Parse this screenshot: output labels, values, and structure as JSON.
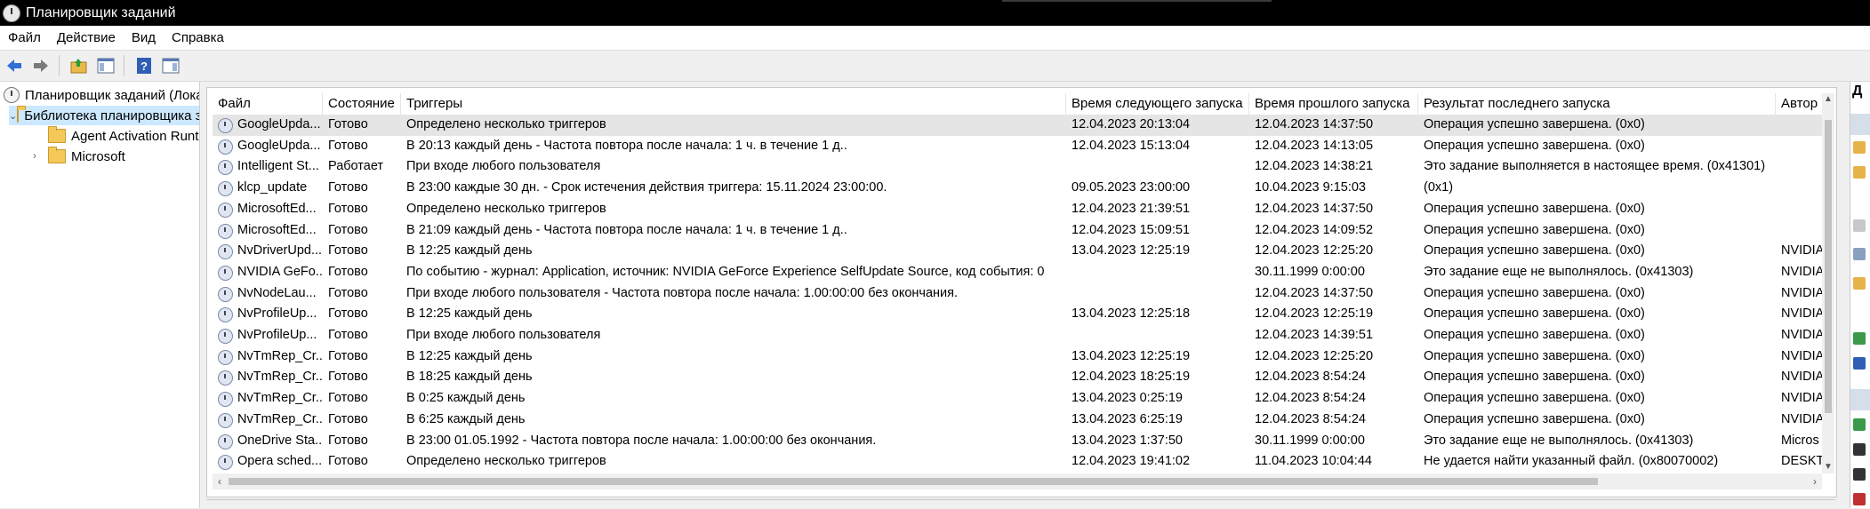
{
  "window": {
    "title": "Планировщик заданий"
  },
  "menu": [
    "Файл",
    "Действие",
    "Вид",
    "Справка"
  ],
  "tree": {
    "root": "Планировщик заданий (Локальный)",
    "library": "Библиотека планировщика заданий",
    "children": [
      "Agent Activation Runtime",
      "Microsoft"
    ]
  },
  "table": {
    "columns": [
      "Файл",
      "Состояние",
      "Триггеры",
      "Время следующего запуска",
      "Время прошлого запуска",
      "Результат последнего запуска",
      "Автор"
    ],
    "rows": [
      [
        "GoogleUpda...",
        "Готово",
        "Определено несколько триггеров",
        "12.04.2023 20:13:04",
        "12.04.2023 14:37:50",
        "Операция успешно завершена. (0x0)",
        ""
      ],
      [
        "GoogleUpda...",
        "Готово",
        "В 20:13 каждый день - Частота повтора после начала: 1 ч. в течение 1 д..",
        "12.04.2023 15:13:04",
        "12.04.2023 14:13:05",
        "Операция успешно завершена. (0x0)",
        ""
      ],
      [
        "Intelligent St...",
        "Работает",
        "При входе любого пользователя",
        "",
        "12.04.2023 14:38:21",
        "Это задание выполняется в настоящее время. (0x41301)",
        ""
      ],
      [
        "klcp_update",
        "Готово",
        "В 23:00 каждые 30 дн. - Срок истечения действия триггера: 15.11.2024 23:00:00.",
        "09.05.2023 23:00:00",
        "10.04.2023 9:15:03",
        "(0x1)",
        ""
      ],
      [
        "MicrosoftEd...",
        "Готово",
        "Определено несколько триггеров",
        "12.04.2023 21:39:51",
        "12.04.2023 14:37:50",
        "Операция успешно завершена. (0x0)",
        ""
      ],
      [
        "MicrosoftEd...",
        "Готово",
        "В 21:09 каждый день - Частота повтора после начала: 1 ч. в течение 1 д..",
        "12.04.2023 15:09:51",
        "12.04.2023 14:09:52",
        "Операция успешно завершена. (0x0)",
        ""
      ],
      [
        "NvDriverUpd...",
        "Готово",
        "В 12:25 каждый день",
        "13.04.2023 12:25:19",
        "12.04.2023 12:25:20",
        "Операция успешно завершена. (0x0)",
        "NVIDIA"
      ],
      [
        "NVIDIA GeFo...",
        "Готово",
        "По событию - журнал: Application, источник: NVIDIA GeForce Experience SelfUpdate Source, код события: 0",
        "",
        "30.11.1999 0:00:00",
        "Это задание еще не выполнялось. (0x41303)",
        "NVIDIA"
      ],
      [
        "NvNodeLau...",
        "Готово",
        "При входе любого пользователя - Частота повтора после начала: 1.00:00:00 без окончания.",
        "",
        "12.04.2023 14:37:50",
        "Операция успешно завершена. (0x0)",
        "NVIDIA"
      ],
      [
        "NvProfileUp...",
        "Готово",
        "В 12:25 каждый день",
        "13.04.2023 12:25:18",
        "12.04.2023 12:25:19",
        "Операция успешно завершена. (0x0)",
        "NVIDIA"
      ],
      [
        "NvProfileUp...",
        "Готово",
        "При входе любого пользователя",
        "",
        "12.04.2023 14:39:51",
        "Операция успешно завершена. (0x0)",
        "NVIDIA"
      ],
      [
        "NvTmRep_Cr...",
        "Готово",
        "В 12:25 каждый день",
        "13.04.2023 12:25:19",
        "12.04.2023 12:25:20",
        "Операция успешно завершена. (0x0)",
        "NVIDIA"
      ],
      [
        "NvTmRep_Cr...",
        "Готово",
        "В 18:25 каждый день",
        "12.04.2023 18:25:19",
        "12.04.2023 8:54:24",
        "Операция успешно завершена. (0x0)",
        "NVIDIA"
      ],
      [
        "NvTmRep_Cr...",
        "Готово",
        "В 0:25 каждый день",
        "13.04.2023 0:25:19",
        "12.04.2023 8:54:24",
        "Операция успешно завершена. (0x0)",
        "NVIDIA"
      ],
      [
        "NvTmRep_Cr...",
        "Готово",
        "В 6:25 каждый день",
        "13.04.2023 6:25:19",
        "12.04.2023 8:54:24",
        "Операция успешно завершена. (0x0)",
        "NVIDIA"
      ],
      [
        "OneDrive Sta...",
        "Готово",
        "В 23:00 01.05.1992 - Частота повтора после начала: 1.00:00:00 без окончания.",
        "13.04.2023 1:37:50",
        "30.11.1999 0:00:00",
        "Это задание еще не выполнялось. (0x41303)",
        "Micros"
      ],
      [
        "Opera sched...",
        "Готово",
        "Определено несколько триггеров",
        "12.04.2023 19:41:02",
        "11.04.2023 10:04:44",
        "Не удается найти указанный файл. (0x80070002)",
        "DESKT"
      ]
    ]
  },
  "actions_pane": {
    "header": "Д"
  },
  "colors": {
    "selection": "#cce8ff",
    "row_selected": "#e5e5e5",
    "title_bar": "#000000"
  }
}
